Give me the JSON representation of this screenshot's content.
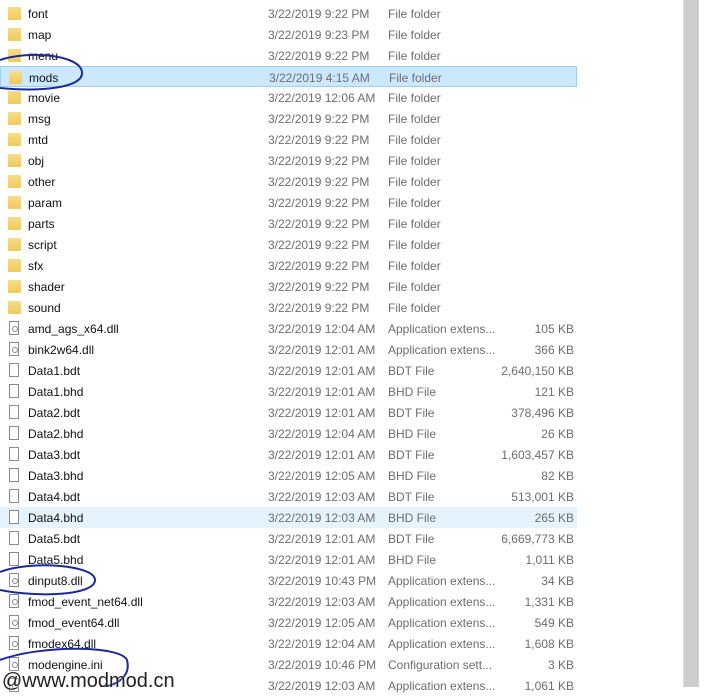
{
  "files": [
    {
      "name": "font",
      "date": "3/22/2019 9:22 PM",
      "type": "File folder",
      "size": "",
      "icon": "folder"
    },
    {
      "name": "map",
      "date": "3/22/2019 9:23 PM",
      "type": "File folder",
      "size": "",
      "icon": "folder"
    },
    {
      "name": "menu",
      "date": "3/22/2019 9:22 PM",
      "type": "File folder",
      "size": "",
      "icon": "folder"
    },
    {
      "name": "mods",
      "date": "3/22/2019 4:15 AM",
      "type": "File folder",
      "size": "",
      "icon": "folder",
      "state": "selected"
    },
    {
      "name": "movie",
      "date": "3/22/2019 12:06 AM",
      "type": "File folder",
      "size": "",
      "icon": "folder"
    },
    {
      "name": "msg",
      "date": "3/22/2019 9:22 PM",
      "type": "File folder",
      "size": "",
      "icon": "folder"
    },
    {
      "name": "mtd",
      "date": "3/22/2019 9:22 PM",
      "type": "File folder",
      "size": "",
      "icon": "folder"
    },
    {
      "name": "obj",
      "date": "3/22/2019 9:22 PM",
      "type": "File folder",
      "size": "",
      "icon": "folder"
    },
    {
      "name": "other",
      "date": "3/22/2019 9:22 PM",
      "type": "File folder",
      "size": "",
      "icon": "folder"
    },
    {
      "name": "param",
      "date": "3/22/2019 9:22 PM",
      "type": "File folder",
      "size": "",
      "icon": "folder"
    },
    {
      "name": "parts",
      "date": "3/22/2019 9:22 PM",
      "type": "File folder",
      "size": "",
      "icon": "folder"
    },
    {
      "name": "script",
      "date": "3/22/2019 9:22 PM",
      "type": "File folder",
      "size": "",
      "icon": "folder"
    },
    {
      "name": "sfx",
      "date": "3/22/2019 9:22 PM",
      "type": "File folder",
      "size": "",
      "icon": "folder"
    },
    {
      "name": "shader",
      "date": "3/22/2019 9:22 PM",
      "type": "File folder",
      "size": "",
      "icon": "folder"
    },
    {
      "name": "sound",
      "date": "3/22/2019 9:22 PM",
      "type": "File folder",
      "size": "",
      "icon": "folder"
    },
    {
      "name": "amd_ags_x64.dll",
      "date": "3/22/2019 12:04 AM",
      "type": "Application extens...",
      "size": "105 KB",
      "icon": "app"
    },
    {
      "name": "bink2w64.dll",
      "date": "3/22/2019 12:01 AM",
      "type": "Application extens...",
      "size": "366 KB",
      "icon": "app"
    },
    {
      "name": "Data1.bdt",
      "date": "3/22/2019 12:01 AM",
      "type": "BDT File",
      "size": "2,640,150 KB",
      "icon": "file"
    },
    {
      "name": "Data1.bhd",
      "date": "3/22/2019 12:01 AM",
      "type": "BHD File",
      "size": "121 KB",
      "icon": "file"
    },
    {
      "name": "Data2.bdt",
      "date": "3/22/2019 12:01 AM",
      "type": "BDT File",
      "size": "378,496 KB",
      "icon": "file"
    },
    {
      "name": "Data2.bhd",
      "date": "3/22/2019 12:04 AM",
      "type": "BHD File",
      "size": "26 KB",
      "icon": "file"
    },
    {
      "name": "Data3.bdt",
      "date": "3/22/2019 12:01 AM",
      "type": "BDT File",
      "size": "1,603,457 KB",
      "icon": "file"
    },
    {
      "name": "Data3.bhd",
      "date": "3/22/2019 12:05 AM",
      "type": "BHD File",
      "size": "82 KB",
      "icon": "file"
    },
    {
      "name": "Data4.bdt",
      "date": "3/22/2019 12:03 AM",
      "type": "BDT File",
      "size": "513,001 KB",
      "icon": "file"
    },
    {
      "name": "Data4.bhd",
      "date": "3/22/2019 12:03 AM",
      "type": "BHD File",
      "size": "265 KB",
      "icon": "file",
      "state": "hover"
    },
    {
      "name": "Data5.bdt",
      "date": "3/22/2019 12:01 AM",
      "type": "BDT File",
      "size": "6,669,773 KB",
      "icon": "file"
    },
    {
      "name": "Data5.bhd",
      "date": "3/22/2019 12:01 AM",
      "type": "BHD File",
      "size": "1,011 KB",
      "icon": "file"
    },
    {
      "name": "dinput8.dll",
      "date": "3/22/2019 10:43 PM",
      "type": "Application extens...",
      "size": "34 KB",
      "icon": "app"
    },
    {
      "name": "fmod_event_net64.dll",
      "date": "3/22/2019 12:03 AM",
      "type": "Application extens...",
      "size": "1,331 KB",
      "icon": "app"
    },
    {
      "name": "fmod_event64.dll",
      "date": "3/22/2019 12:05 AM",
      "type": "Application extens...",
      "size": "549 KB",
      "icon": "app"
    },
    {
      "name": "fmodex64.dll",
      "date": "3/22/2019 12:04 AM",
      "type": "Application extens...",
      "size": "1,608 KB",
      "icon": "app"
    },
    {
      "name": "modengine.ini",
      "date": "3/22/2019 10:46 PM",
      "type": "Configuration sett...",
      "size": "3 KB",
      "icon": "app"
    },
    {
      "name": "",
      "date": "3/22/2019 12:03 AM",
      "type": "Application extens...",
      "size": "1,061 KB",
      "icon": "app"
    }
  ],
  "watermark": "@www.modmod.cn",
  "colors": {
    "selected": "#cce8ff",
    "hover": "#e5f3ff",
    "annotation": "#1a2a9a"
  }
}
